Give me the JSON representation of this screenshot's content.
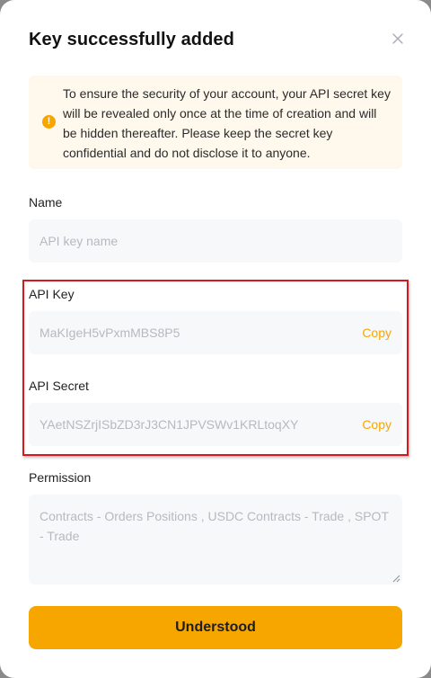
{
  "dialog": {
    "title": "Key successfully added",
    "close_icon": "close-icon"
  },
  "notice": {
    "icon": "warning-circle-icon",
    "text": "To ensure the security of your account, your API secret key will be revealed only once at the time of creation and will be hidden thereafter. Please keep the secret key confidential and do not disclose it to anyone.",
    "background": "#fff8ec",
    "icon_color": "#f7a600"
  },
  "name": {
    "label": "Name",
    "placeholder": "API key name",
    "value": ""
  },
  "api_key": {
    "label": "API Key",
    "value": "MaKIgeH5vPxmMBS8P5",
    "copy_label": "Copy"
  },
  "api_secret": {
    "label": "API Secret",
    "value": "YAetNSZrjISbZD3rJ3CN1JPVSWv1KRLtoqXY",
    "copy_label": "Copy"
  },
  "permission": {
    "label": "Permission",
    "value": "Contracts - Orders Positions  , USDC Contracts - Trade  , SPOT - Trade"
  },
  "actions": {
    "confirm_label": "Understood",
    "accent_color": "#f7a600"
  },
  "annotation": {
    "highlight_color": "#d9181e"
  }
}
